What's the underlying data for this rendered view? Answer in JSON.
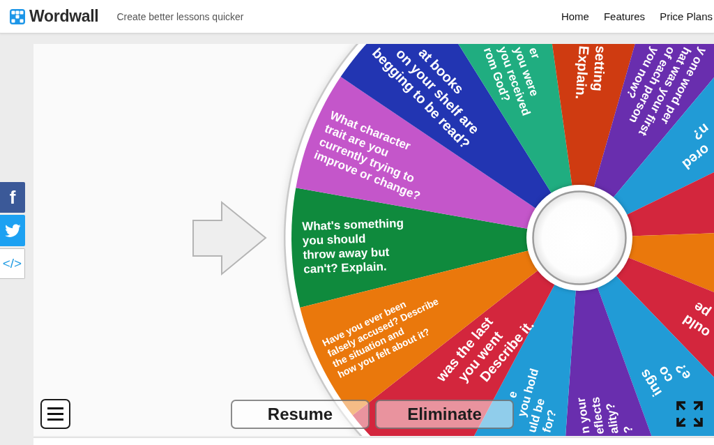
{
  "header": {
    "brand": "Wordwall",
    "tagline": "Create better lessons quicker",
    "nav": [
      {
        "label": "Home"
      },
      {
        "label": "Features"
      },
      {
        "label": "Price Plans"
      }
    ]
  },
  "share_buttons": [
    {
      "kind": "letter",
      "label": "f"
    },
    {
      "kind": "bird"
    },
    {
      "kind": "code",
      "label": "</>"
    }
  ],
  "wheel": {
    "segments": [
      {
        "color": "#0f8a3d",
        "lines": [
          "What's something",
          "you should",
          "throw away but",
          "can't? Explain."
        ]
      },
      {
        "color": "#c456ca",
        "lines": [
          "What character",
          "trait are you",
          "currently trying to",
          "improve or change?"
        ]
      },
      {
        "color": "#2235b2",
        "lines": [
          "at books",
          "on your shelf are",
          "begging to be read?"
        ]
      },
      {
        "color": "#20ad80",
        "lines": [
          "er",
          "you were",
          "you received",
          "rom God?"
        ]
      },
      {
        "color": "#cf3b11",
        "lines": [
          "setting",
          "Explain."
        ]
      },
      {
        "color": "#692eae",
        "lines": [
          "y one word per",
          "hat was your first",
          "of each person",
          "you now?"
        ]
      },
      {
        "color": "#219bd6",
        "lines": [
          "ored",
          "n?"
        ]
      },
      {
        "color": "#d3263d"
      },
      {
        "color": "#ea780c"
      },
      {
        "color": "#d3263d",
        "lines": [
          "ould",
          "pe"
        ]
      },
      {
        "color": "#219bd6",
        "lines": [
          "ings",
          "co",
          "e?"
        ]
      },
      {
        "color": "#692eae",
        "lines": [
          "n your",
          "eflects",
          "ality?",
          "?"
        ]
      },
      {
        "color": "#219bd6",
        "lines": [
          "e",
          "you hold",
          "uld be",
          "for?"
        ]
      },
      {
        "color": "#d3263d",
        "lines": [
          "was the last",
          "you went",
          "Describe it."
        ]
      },
      {
        "color": "#ea780c",
        "lines": [
          "Have you ever been",
          "falsely accused? Describe",
          "the situation and",
          "how you felt about it?"
        ]
      }
    ]
  },
  "controls": {
    "buttons": [
      {
        "label": "Resume"
      },
      {
        "label": "Eliminate"
      }
    ]
  }
}
